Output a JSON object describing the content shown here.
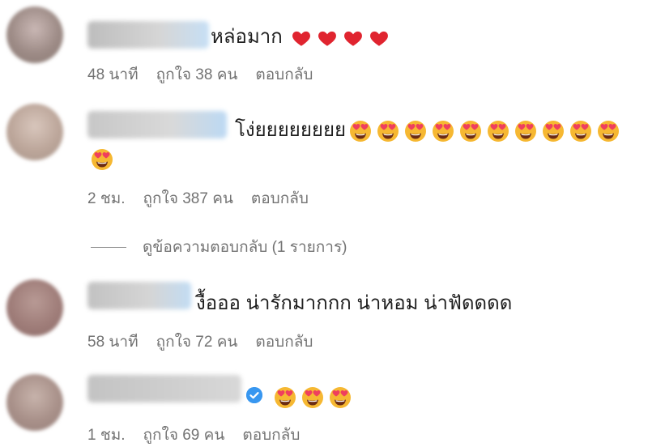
{
  "comments": [
    {
      "text": "หล่อมาก",
      "emoji_kind": "heart",
      "emoji_count": 4,
      "time": "48 นาที",
      "likes": "ถูกใจ 38 คน",
      "reply": "ตอบกลับ"
    },
    {
      "text": "โง่ยยยยยยยย",
      "emoji_kind": "heart-eyes",
      "emoji_count": 11,
      "time": "2 ชม.",
      "likes": "ถูกใจ 387 คน",
      "reply": "ตอบกลับ"
    },
    {
      "text": "งื้อออ น่ารักมากกก น่าหอม น่าฟัดดดด",
      "emoji_kind": "",
      "emoji_count": 0,
      "time": "58 นาที",
      "likes": "ถูกใจ 72 คน",
      "reply": "ตอบกลับ"
    },
    {
      "text": "",
      "emoji_kind": "heart-eyes",
      "emoji_count": 3,
      "verified": true,
      "time": "1 ชม.",
      "likes": "ถูกใจ 69 คน",
      "reply": "ตอบกลับ"
    }
  ],
  "view_replies": "ดูข้อความตอบกลับ (1 รายการ)",
  "colors": {
    "meta": "#737373",
    "heart": "#e0242f",
    "emoji_face": "#f6b832",
    "emoji_heart": "#ef3f5e",
    "verified": "#3897f0",
    "username_blur": "#c9d6e3"
  }
}
